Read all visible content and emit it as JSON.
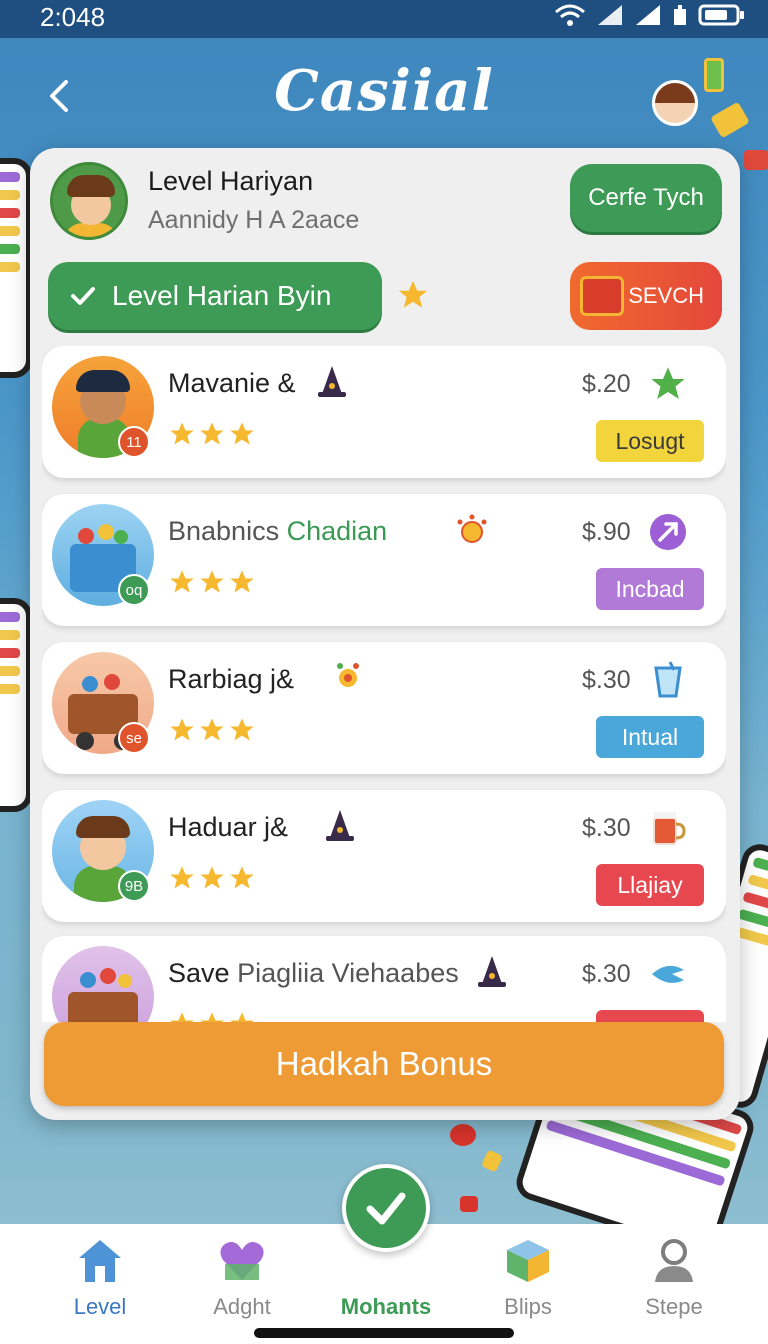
{
  "status_bar": {
    "time": "2:048"
  },
  "header": {
    "title": "Casiial"
  },
  "profile": {
    "name": "Level Hariyan",
    "subtitle": "Aannidy H A 2aace",
    "cta_label": "Cerfe Tych"
  },
  "filters": {
    "level_label": "Level Harian Byin",
    "search_label": "SEVCH"
  },
  "games": [
    {
      "title": "Mavanie &",
      "title_accent": "",
      "price": "$.20",
      "status": "Losugt",
      "status_color": "#f2d43c",
      "badge": "11",
      "badge_color": "#e0542c",
      "rating": 3
    },
    {
      "title": "Bnabnics",
      "title_accent": "Chadian",
      "price": "$.90",
      "status": "Incbad",
      "status_color": "#b07ad6",
      "badge": "oq",
      "badge_color": "#3e9b56",
      "rating": 3
    },
    {
      "title": "Rarbiag j&",
      "title_accent": "",
      "price": "$.30",
      "status": "Intual",
      "status_color": "#4aa7da",
      "badge": "se",
      "badge_color": "#e0542c",
      "rating": 3
    },
    {
      "title": "Haduar j&",
      "title_accent": "",
      "price": "$.30",
      "status": "Llajiay",
      "status_color": "#e7484f",
      "badge": "9B",
      "badge_color": "#3e9b56",
      "rating": 3
    },
    {
      "title": "Save",
      "title_accent": "Piagliia Viehaabes",
      "price": "$.30",
      "status": "",
      "status_color": "#e7484f",
      "badge": "",
      "badge_color": "#3e9b56",
      "rating": 3
    }
  ],
  "bonus_button": {
    "label": "Hadkah Bonus"
  },
  "nav": [
    {
      "label": "Level",
      "icon": "home-icon"
    },
    {
      "label": "Adght",
      "icon": "heart-icon"
    },
    {
      "label": "Mohants",
      "icon": "check-icon"
    },
    {
      "label": "Blips",
      "icon": "cube-icon"
    },
    {
      "label": "Stepe",
      "icon": "user-icon"
    }
  ],
  "colors": {
    "accent_green": "#3e9b56",
    "header_blue": "#3e86bd",
    "bonus_orange": "#ee9a35"
  }
}
